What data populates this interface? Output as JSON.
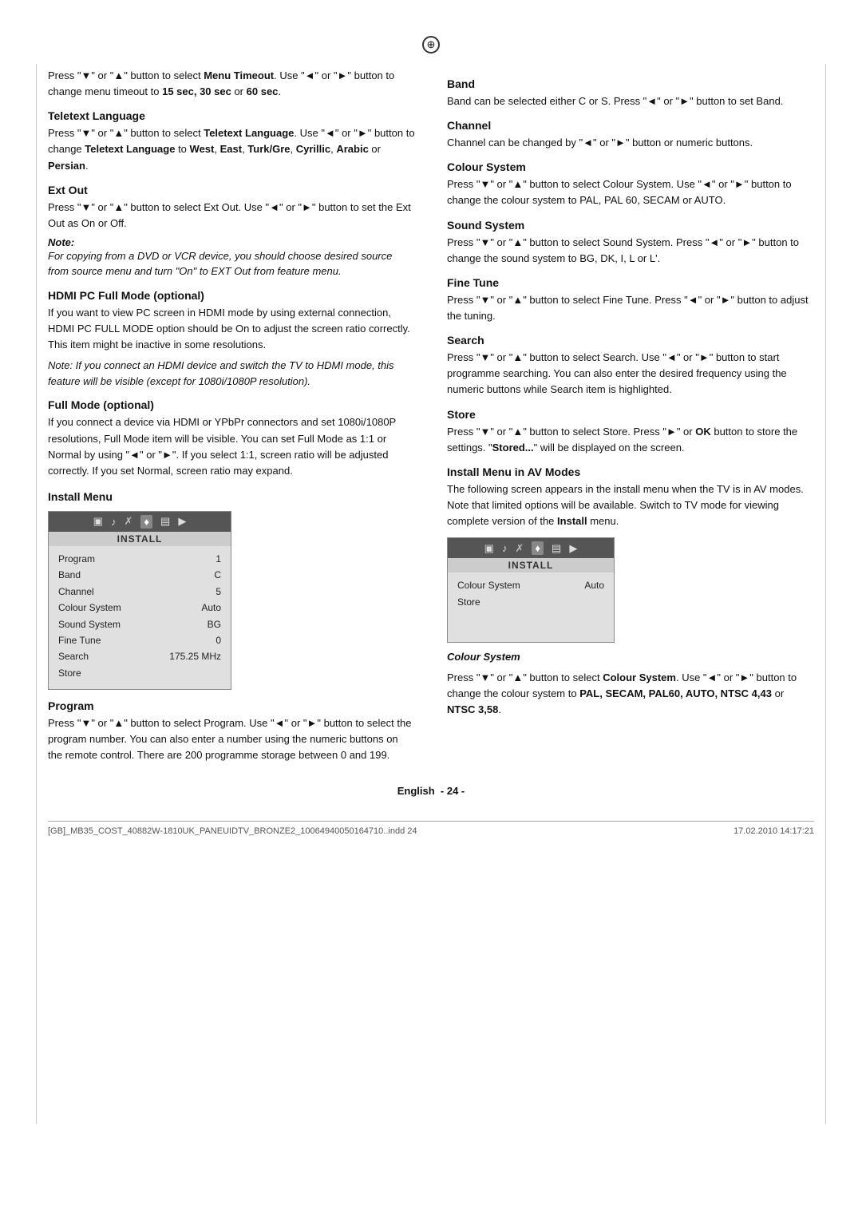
{
  "page": {
    "top_icon": "⊕",
    "footer_left": "[GB]_MB35_COST_40882W-1810UK_PANEUIDTV_BRONZE2_10064940050164710..indd  24",
    "footer_right": "17.02.2010  14:17:21",
    "page_label": "English",
    "page_number": "- 24 -"
  },
  "left_col": {
    "intro": {
      "text": "Press \"▼\" or \"▲\" button to select Menu Timeout. Use \"◄\" or \"►\" button to change menu timeout to 15 sec, 30 sec or 60 sec."
    },
    "teletext_language": {
      "heading": "Teletext Language",
      "text": "Press \"▼\" or \"▲\" button to select Teletext Language. Use \"◄\" or \"►\" button to change Teletext Language to West, East, Turk/Gre, Cyrillic, Arabic or Persian."
    },
    "ext_out": {
      "heading": "Ext Out",
      "text": "Press \"▼\" or \"▲\" button to select Ext Out. Use \"◄\" or \"►\" button to set the Ext Out as On or Off.",
      "note_label": "Note:",
      "note_text": "For copying from a DVD or VCR device, you should choose desired source from source menu and turn \"On\" to EXT Out from feature menu."
    },
    "hdmi_pc": {
      "heading": "HDMI PC Full Mode (optional)",
      "text": "If you want to view PC screen in HDMI mode by using external connection, HDMI PC FULL MODE option should be On to adjust the screen ratio correctly. This item might be inactive in some resolutions.",
      "note_text": "Note: If you connect an HDMI device and switch the TV to HDMI mode, this feature will be visible (except for 1080i/1080P resolution)."
    },
    "full_mode": {
      "heading": "Full Mode (optional)",
      "text": "If you connect a device via HDMI or YPbPr connectors and set 1080i/1080P resolutions, Full Mode item will be visible. You can set Full Mode as 1:1 or Normal by using \"◄\" or \"►\". If you select 1:1, screen ratio will be adjusted correctly. If you set Normal, screen ratio may expand."
    },
    "install_menu": {
      "heading": "Install Menu",
      "icons": [
        "▣",
        "♪",
        "✗",
        "♦",
        "▤",
        "▶"
      ],
      "active_icon_index": 3,
      "title": "INSTALL",
      "rows": [
        {
          "label": "Program",
          "value": "1"
        },
        {
          "label": "Band",
          "value": "C"
        },
        {
          "label": "Channel",
          "value": "5"
        },
        {
          "label": "Colour System",
          "value": "Auto"
        },
        {
          "label": "Sound System",
          "value": "BG"
        },
        {
          "label": "Fine Tune",
          "value": "0"
        },
        {
          "label": "Search",
          "value": "175.25 MHz"
        },
        {
          "label": "Store",
          "value": ""
        }
      ]
    },
    "program": {
      "heading": "Program",
      "text": "Press \"▼\" or \"▲\" button to select Program. Use \"◄\" or \"►\" button to select the program number. You can also enter a number using the numeric buttons on the remote control. There are 200 programme storage between 0 and 199."
    }
  },
  "right_col": {
    "band": {
      "heading": "Band",
      "text": "Band can be selected either C or S. Press \"◄\" or \"►\" button to set Band."
    },
    "channel": {
      "heading": "Channel",
      "text": "Channel can be changed by \"◄\" or \"►\" button or numeric buttons."
    },
    "colour_system": {
      "heading": "Colour System",
      "text": "Press \"▼\" or \"▲\" button to select Colour System. Use \"◄\" or \"►\" button to change the colour system to PAL, PAL 60, SECAM or AUTO."
    },
    "sound_system": {
      "heading": "Sound System",
      "text": "Press \"▼\" or \"▲\" button to select  Sound System. Press \"◄\" or \"►\" button to change the sound system to BG, DK, I, L or L'."
    },
    "fine_tune": {
      "heading": "Fine Tune",
      "text": "Press \"▼\" or \"▲\" button to select Fine Tune. Press \"◄\" or \"►\" button to adjust the tuning."
    },
    "search": {
      "heading": "Search",
      "text": "Press \"▼\" or \"▲\" button to select Search. Use \"◄\" or \"►\" button to start programme searching. You can also enter the desired frequency using the numeric buttons while Search item is highlighted."
    },
    "store": {
      "heading": "Store",
      "text": "Press \"▼\" or \"▲\" button to select Store. Press \"►\" or OK button to store the settings. \"Stored...\" will be displayed on the screen."
    },
    "install_menu_av": {
      "heading": "Install Menu in AV Modes",
      "intro": "The following screen appears in the install menu when the TV is in AV modes. Note that limited options will be available. Switch to TV mode for viewing complete version of the Install menu.",
      "icons": [
        "▣",
        "♪",
        "✗",
        "♦",
        "▤",
        "▶"
      ],
      "active_icon_index": 3,
      "title": "INSTALL",
      "rows": [
        {
          "label": "Colour System",
          "value": "Auto"
        },
        {
          "label": "Store",
          "value": ""
        }
      ]
    },
    "colour_system_note": {
      "label": "Colour System",
      "text": "Press \"▼\" or \"▲\" button to select Colour System. Use \"◄\" or \"►\" button to change the colour system to PAL, SECAM, PAL60, AUTO, NTSC 4,43 or NTSC 3,58."
    }
  }
}
